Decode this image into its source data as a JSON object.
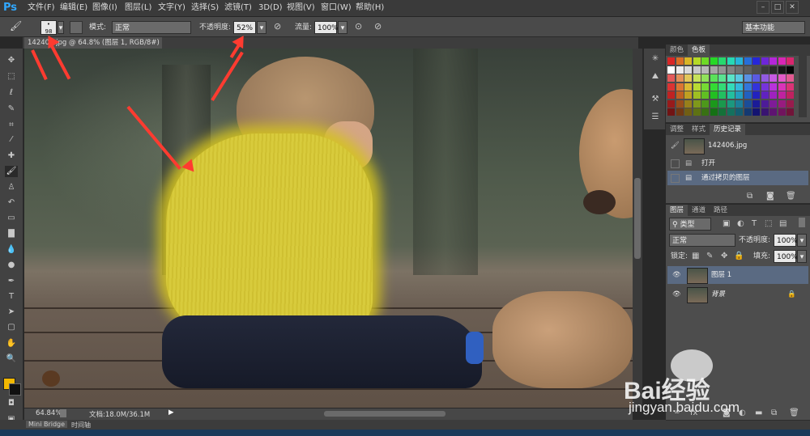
{
  "app": {
    "logo": "Ps"
  },
  "menu": [
    "文件(F)",
    "编辑(E)",
    "图像(I)",
    "图层(L)",
    "文字(Y)",
    "选择(S)",
    "滤镜(T)",
    "3D(D)",
    "视图(V)",
    "窗口(W)",
    "帮助(H)"
  ],
  "window_controls": {
    "minimize": "–",
    "maximize": "□",
    "close": "✕"
  },
  "options": {
    "brush_size": "98",
    "mode_label": "模式:",
    "mode_value": "正常",
    "opacity_label": "不透明度:",
    "opacity_value": "52%",
    "flow_label": "流量:",
    "flow_value": "100%",
    "workspace": "基本功能"
  },
  "document": {
    "tab_title": "142406.jpg @ 64.8% (图层 1, RGB/8#) *",
    "zoom": "64.84%",
    "doc_info": "文档:18.0M/36.1M"
  },
  "bottom_tabs": [
    "Mini Bridge",
    "时间轴"
  ],
  "color_panel": {
    "tabs": [
      "颜色",
      "色板"
    ],
    "active": "色板"
  },
  "history_panel": {
    "tabs": [
      "调整",
      "样式",
      "历史记录"
    ],
    "active": "历史记录",
    "snapshot": "142406.jpg",
    "items": [
      "打开",
      "通过拷贝的图层"
    ]
  },
  "layers_panel": {
    "tabs": [
      "图层",
      "通道",
      "路径"
    ],
    "active": "图层",
    "filter_label": "类型",
    "blend_mode": "正常",
    "opacity_label": "不透明度:",
    "opacity_value": "100%",
    "lock_label": "锁定:",
    "fill_label": "填充:",
    "fill_value": "100%",
    "layers": [
      {
        "name": "图层 1",
        "selected": true
      },
      {
        "name": "背景",
        "selected": false
      }
    ]
  },
  "watermark": {
    "brand": "Bai经验",
    "url": "jingyan.baidu.com"
  },
  "colors": {
    "accent": "#31a8ff",
    "fg_color": "#f2b800",
    "bg_color": "#111111",
    "arrow": "#ff3b30"
  }
}
